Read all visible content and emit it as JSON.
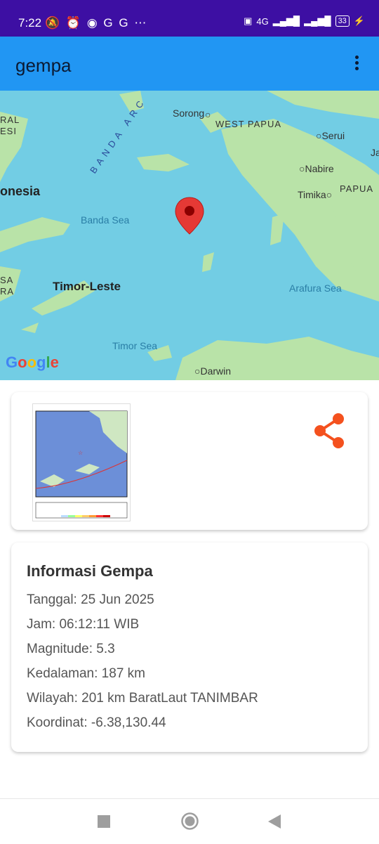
{
  "status_bar": {
    "time": "7:22",
    "left_icons": [
      "mute-icon",
      "alarm-icon",
      "app-icon",
      "G",
      "G",
      "more-icon"
    ],
    "right_text": "4G",
    "battery": "33"
  },
  "app_bar": {
    "title": "gempa",
    "overflow_icon": "more-vert-icon"
  },
  "map": {
    "labels": {
      "sorong": "Sorong",
      "west_papua": "WEST PAPUA",
      "serui": "Serui",
      "nabire": "Nabire",
      "timika": "Timika",
      "papua": "PAPUA",
      "banda_arc": "BANDA ARC",
      "indonesia": "onesia",
      "banda_sea": "Banda Sea",
      "timor_leste": "Timor-Leste",
      "arafura_sea": "Arafura Sea",
      "timor_sea": "Timor Sea",
      "darwin": "Darwin",
      "ral": "RAL",
      "wesi": "ESI",
      "sa": "SA",
      "ra": "RA",
      "ja": "Ja"
    },
    "google": "Google",
    "marker_icon": "location-pin-icon"
  },
  "shakemap_card": {
    "thumbnail_icon": "shakemap-image",
    "share_icon": "share-icon",
    "colors": {
      "share": "#f4511e"
    }
  },
  "info_card": {
    "title": "Informasi Gempa",
    "tanggal": "Tanggal: 25 Jun 2025",
    "jam": "Jam: 06:12:11 WIB",
    "magnitude": "Magnitude: 5.3",
    "kedalaman": "Kedalaman: 187 km",
    "wilayah": "Wilayah: 201 km BaratLaut TANIMBAR",
    "koordinat": "Koordinat: -6.38,130.44"
  },
  "nav": {
    "recent_icon": "square-icon",
    "home_icon": "circle-icon",
    "back_icon": "triangle-back-icon"
  },
  "colors": {
    "status_bar": "#3d0fa3",
    "app_bar": "#2196f3",
    "sea": "#72cde4",
    "land": "#b7e2a7"
  }
}
